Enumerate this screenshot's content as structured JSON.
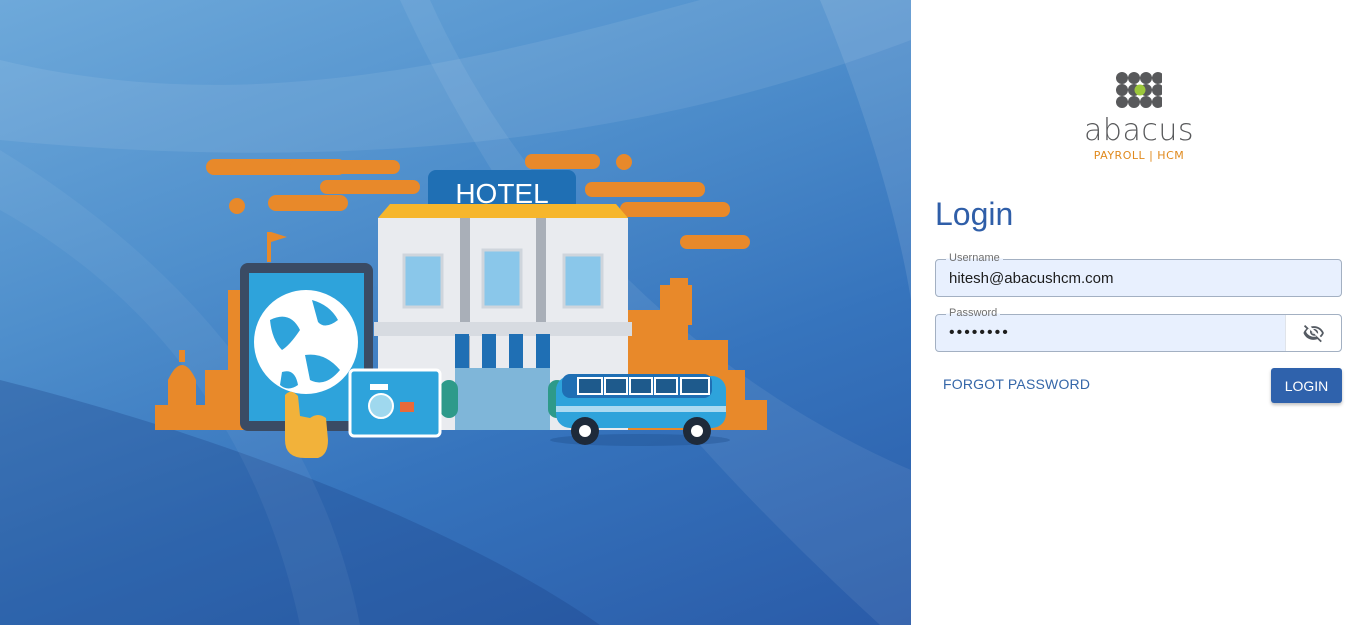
{
  "brand": {
    "logo_word": "abacus",
    "logo_sub": "PAYROLL | HCM",
    "colors": {
      "primary": "#2f5ea8",
      "accent_orange": "#e08a1e",
      "logo_gray": "#58595b",
      "logo_green": "#9cc73b"
    }
  },
  "hero": {
    "hotel_sign": "HOTEL"
  },
  "login": {
    "title": "Login",
    "username": {
      "label": "Username",
      "value": "hitesh@abacushcm.com"
    },
    "password": {
      "label": "Password",
      "value": "••••••••",
      "toggle_icon": "eye-off-icon"
    },
    "forgot_label": "FORGOT PASSWORD",
    "submit_label": "LOGIN"
  }
}
